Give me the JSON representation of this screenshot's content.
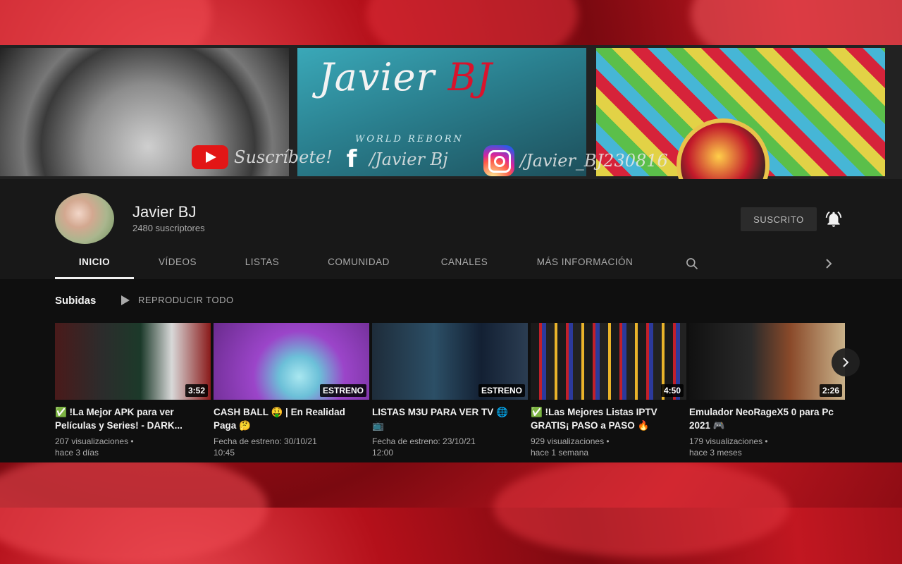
{
  "banner": {
    "title_part1": "Javier ",
    "title_part2": "BJ",
    "tagline": "WORLD REBORN",
    "subscribe_text": "Suscríbete!",
    "facebook_text": "/Javier Bj",
    "instagram_text": "/Javier_BJ230816"
  },
  "channel": {
    "name": "Javier BJ",
    "subscribers": "2480 suscriptores",
    "subscribed_label": "SUSCRITO"
  },
  "tabs": [
    "INICIO",
    "VÍDEOS",
    "LISTAS",
    "COMUNIDAD",
    "CANALES",
    "MÁS INFORMACIÓN"
  ],
  "section": {
    "title": "Subidas",
    "play_all": "REPRODUCIR TODO"
  },
  "videos": [
    {
      "title": "✅ !La Mejor APK para ver Películas y Series! - DARK...",
      "badge": "3:52",
      "meta1": "207 visualizaciones •",
      "meta2": "hace 3 días"
    },
    {
      "title": "CASH BALL 🤑 | En Realidad Paga 🤔",
      "badge": "ESTRENO",
      "meta1": "Fecha de estreno: 30/10/21",
      "meta2": "10:45"
    },
    {
      "title": "LISTAS M3U PARA VER TV 🌐 📺",
      "badge": "ESTRENO",
      "meta1": "Fecha de estreno: 23/10/21",
      "meta2": "12:00"
    },
    {
      "title": "✅ !Las Mejores Listas IPTV GRATIS¡ PASO a PASO 🔥",
      "badge": "4:50",
      "meta1": "929 visualizaciones •",
      "meta2": "hace 1 semana"
    },
    {
      "title": "Emulador NeoRageX5 0 para Pc 2021 🎮",
      "badge": "2:26",
      "meta1": "179 visualizaciones •",
      "meta2": "hace 3 meses"
    }
  ],
  "colors": {
    "accent_red": "#e21616",
    "frame_bg": "#181818",
    "content_bg": "#0f0f0f"
  }
}
